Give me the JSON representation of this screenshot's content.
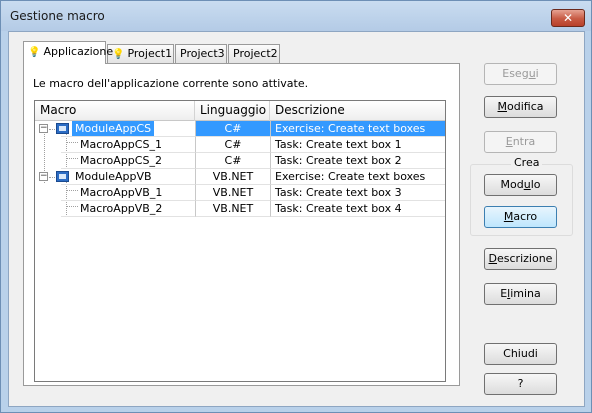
{
  "window": {
    "title": "Gestione macro",
    "close_glyph": "✕"
  },
  "tabs": [
    {
      "label": "Applicazione",
      "icon": "bulb-icon",
      "active": true
    },
    {
      "label": "Project1",
      "icon": "bulb-icon",
      "active": false
    },
    {
      "label": "Project3",
      "active": false
    },
    {
      "label": "Project2",
      "active": false
    }
  ],
  "info_text": "Le macro dell'applicazione corrente sono attivate.",
  "grid": {
    "columns": [
      "Macro",
      "Linguaggio",
      "Descrizione"
    ],
    "rows": [
      {
        "name": "ModuleAppCS",
        "language": "C#",
        "description": "Exercise: Create text boxes",
        "level": 0,
        "selected": true
      },
      {
        "name": "MacroAppCS_1",
        "language": "C#",
        "description": "Task: Create text box 1",
        "level": 1
      },
      {
        "name": "MacroAppCS_2",
        "language": "C#",
        "description": "Task: Create text box 2",
        "level": 1
      },
      {
        "name": "ModuleAppVB",
        "language": "VB.NET",
        "description": "Exercise: Create text boxes",
        "level": 0
      },
      {
        "name": "MacroAppVB_1",
        "language": "VB.NET",
        "description": "Task: Create text box 3",
        "level": 1
      },
      {
        "name": "MacroAppVB_2",
        "language": "VB.NET",
        "description": "Task: Create text box 4",
        "level": 1
      }
    ],
    "expander_glyph": "−"
  },
  "buttons": {
    "esegui": {
      "pre": "Eseg",
      "key": "u",
      "post": "i"
    },
    "modifica": {
      "pre": "",
      "key": "M",
      "post": "odifica"
    },
    "entra": {
      "pre": "",
      "key": "E",
      "post": "ntra"
    },
    "crea_label": "Crea",
    "modulo": {
      "pre": "Mod",
      "key": "u",
      "post": "lo"
    },
    "macro": {
      "pre": "",
      "key": "M",
      "post": "acro"
    },
    "descrizione": {
      "pre": "",
      "key": "D",
      "post": "escrizione"
    },
    "elimina": {
      "pre": "E",
      "key": "l",
      "post": "imina"
    },
    "chiudi": "Chiudi",
    "help": "?"
  },
  "colors": {
    "selection": "#3399ff",
    "window_frame": "#b9d1ea",
    "dialog_bg": "#f0f0f0"
  }
}
